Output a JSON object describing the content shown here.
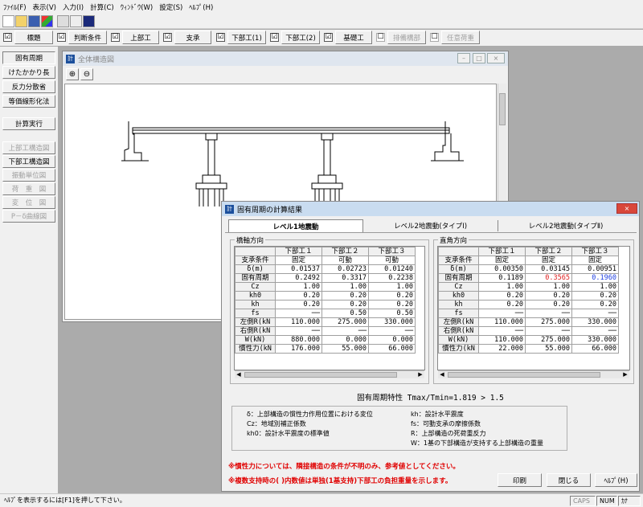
{
  "menu": [
    "ﾌｧｲﾙ(F)",
    "表示(V)",
    "入力(I)",
    "計算(C)",
    "ｳｨﾝﾄﾞｳ(W)",
    "設定(S)",
    "ﾍﾙﾌﾟ(H)"
  ],
  "toolbar_icons": [
    "new-file-icon",
    "open-folder-icon",
    "save-icon",
    "palette-icon",
    "print-icon",
    "print-preview-icon",
    "help-pointer-icon"
  ],
  "toolbar2": [
    {
      "label": "標題",
      "checked": "☑",
      "enabled": true
    },
    {
      "label": "判断条件",
      "checked": "☑",
      "enabled": true
    },
    {
      "label": "上部工",
      "checked": "☑",
      "enabled": true
    },
    {
      "label": "支承",
      "checked": "☑",
      "enabled": true
    },
    {
      "label": "下部工(1)",
      "checked": "☑",
      "enabled": true
    },
    {
      "label": "下部工(2)",
      "checked": "☑",
      "enabled": true
    },
    {
      "label": "基礎工",
      "checked": "☑",
      "enabled": true
    },
    {
      "label": "排備構部",
      "checked": "☐",
      "enabled": false
    },
    {
      "label": "任意荷重",
      "checked": "☐",
      "enabled": false
    }
  ],
  "sidebar": {
    "items": [
      {
        "label": "固有周期",
        "enabled": true
      },
      {
        "label": "けたかかり長",
        "enabled": true
      },
      {
        "label": "反力分散省",
        "enabled": true
      },
      {
        "label": "等価線形化法",
        "enabled": true
      },
      {
        "label": "計算実行",
        "enabled": true
      },
      {
        "label": "上部工構造図",
        "enabled": false
      },
      {
        "label": "下部工構造図",
        "enabled": true
      },
      {
        "label": "振動単位図",
        "enabled": false
      },
      {
        "label": "荷　重　図",
        "enabled": false
      },
      {
        "label": "変　位　図",
        "enabled": false
      },
      {
        "label": "P－δ曲線図",
        "enabled": false
      }
    ]
  },
  "structure_window": {
    "title": "全体構造図",
    "zoom_in": "⊕",
    "zoom_out": "⊖",
    "buttons": {
      "min": "–",
      "max": "□",
      "close": "×"
    }
  },
  "dialog": {
    "title": "固有周期の計算結果",
    "close": "×",
    "tabs": [
      "レベル1地震動",
      "レベル2地震動(タイプⅠ)",
      "レベル2地震動(タイプⅡ)"
    ],
    "bridge_axis": {
      "label": "橋軸方向",
      "header": [
        "",
        "下部工１",
        "下部工２",
        "下部工３"
      ],
      "rows": [
        [
          "支承条件",
          "固定",
          "可動",
          "可動"
        ],
        [
          "δ(m)",
          "0.01537",
          "0.02723",
          "0.01240"
        ],
        [
          "固有周期",
          "0.2492",
          "0.3317",
          "0.2238"
        ],
        [
          "Cz",
          "1.00",
          "1.00",
          "1.00"
        ],
        [
          "kh0",
          "0.20",
          "0.20",
          "0.20"
        ],
        [
          "kh",
          "0.20",
          "0.20",
          "0.20"
        ],
        [
          "fs",
          "──",
          "0.50",
          "0.50"
        ],
        [
          "左側R(kN",
          "110.000",
          "275.000",
          "330.000"
        ],
        [
          "右側R(kN",
          "──",
          "──",
          "──"
        ],
        [
          "W(kN)",
          "880.000",
          "0.000",
          "0.000"
        ],
        [
          "慣性力(kN",
          "176.000",
          "55.000",
          "66.000"
        ]
      ]
    },
    "perpendicular": {
      "label": "直角方向",
      "header": [
        "",
        "下部工１",
        "下部工２",
        "下部工３"
      ],
      "rows": [
        [
          "支承条件",
          "固定",
          "固定",
          "固定"
        ],
        [
          "δ(m)",
          "0.00350",
          "0.03145",
          "0.00951"
        ],
        [
          "固有周期",
          "0.1189",
          "0.3565",
          "0.1960"
        ],
        [
          "Cz",
          "1.00",
          "1.00",
          "1.00"
        ],
        [
          "kh0",
          "0.20",
          "0.20",
          "0.20"
        ],
        [
          "kh",
          "0.20",
          "0.20",
          "0.20"
        ],
        [
          "fs",
          "──",
          "──",
          "──"
        ],
        [
          "左側R(kN",
          "110.000",
          "275.000",
          "330.000"
        ],
        [
          "右側R(kN",
          "──",
          "──",
          "──"
        ],
        [
          "W(kN)",
          "110.000",
          "275.000",
          "330.000"
        ],
        [
          "慣性力(kN",
          "22.000",
          "55.000",
          "66.000"
        ]
      ]
    },
    "ratio_text": "固有周期特性 Tmax/Tmin=1.819 > 1.5",
    "legend_left": [
      "δ：上部構造の慣性力作用位置における変位",
      "Cz：地域別補正係数",
      "kh0：設計水平震度の標準値"
    ],
    "legend_right": [
      "kh：設計水平震度",
      "fs：可動支承の摩擦係数",
      "R：上部構造の死荷重反力",
      "W：1基の下部構造が支持する上部構造の重量"
    ],
    "warnings": [
      "※慣性力については、隣接構造の条件が不明のみ、参考値としてください。",
      "※複数支持時の( )内数値は単独(1基支持)下部工の負担重量を示します。"
    ],
    "buttons": {
      "print": "印刷",
      "close": "閉じる",
      "help": "ﾍﾙﾌﾟ(H)"
    }
  },
  "statusbar": {
    "help": "ﾍﾙﾌﾟを表示するには[F1]を押して下さい。",
    "caps": "CAPS",
    "num": "NUM",
    "kana": "ｶﾅ"
  }
}
